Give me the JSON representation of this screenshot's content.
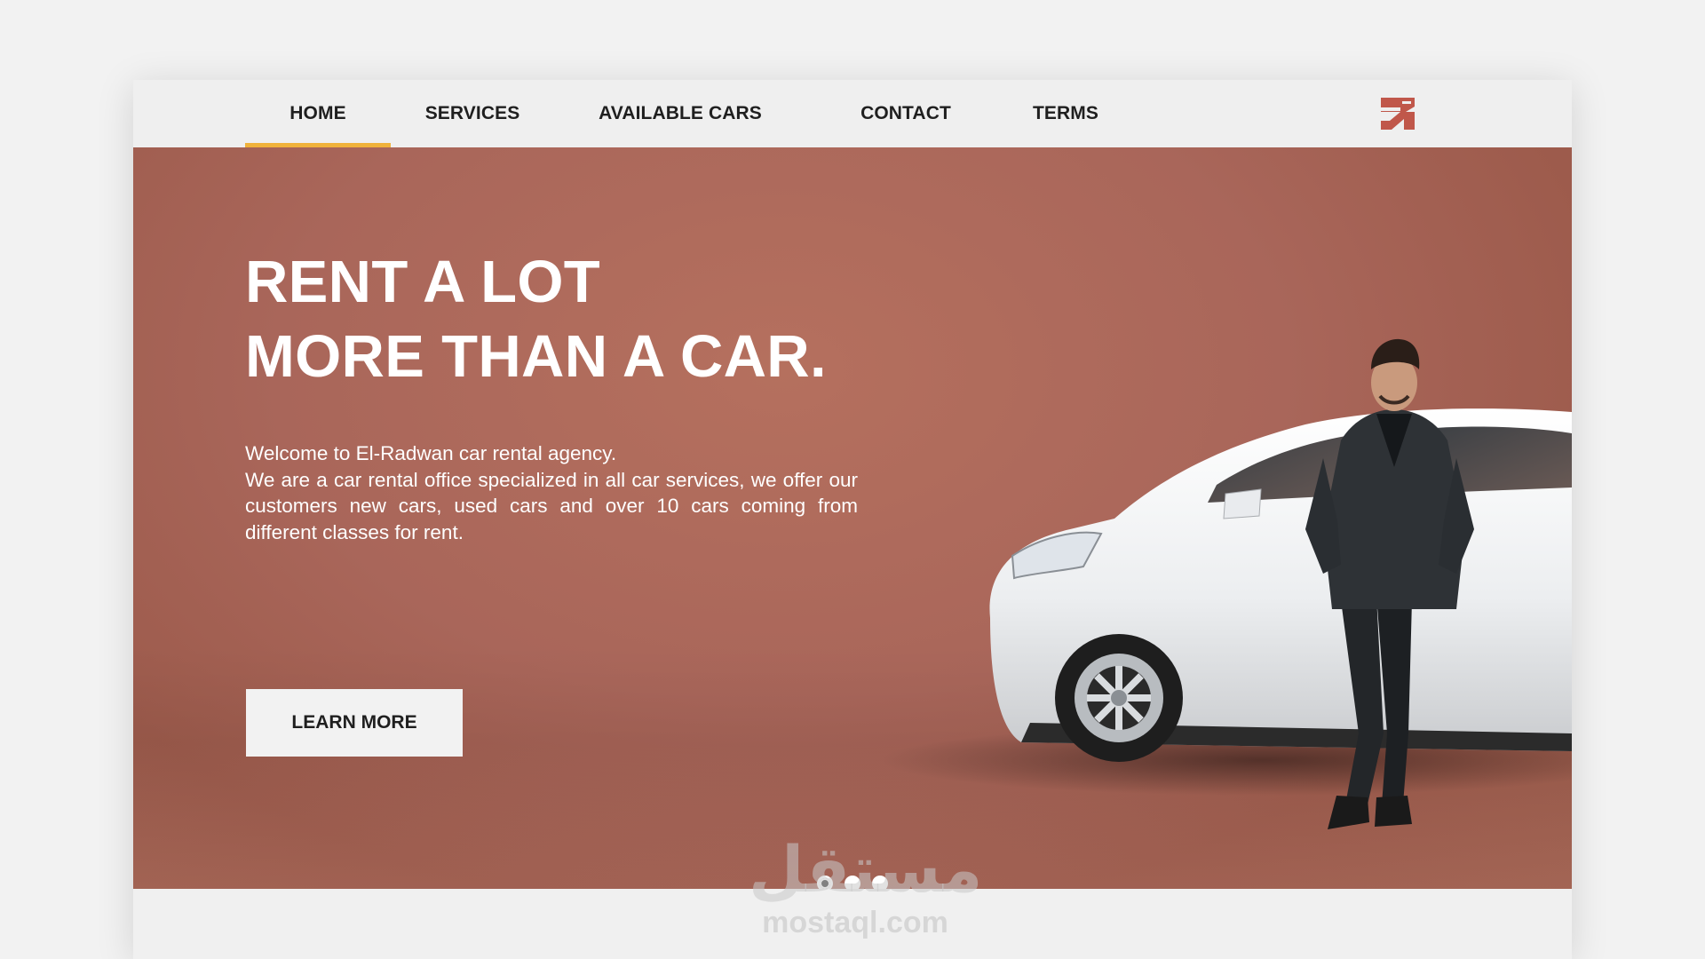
{
  "nav": {
    "items": [
      {
        "label": "HOME",
        "active": true
      },
      {
        "label": "SERVICES",
        "active": false
      },
      {
        "label": "AVAILABLE CARS",
        "active": false
      },
      {
        "label": "CONTACT",
        "active": false
      },
      {
        "label": "TERMS",
        "active": false
      }
    ],
    "active_underline_color": "#f0b23b",
    "logo_icon": "er-monogram-logo"
  },
  "hero": {
    "headline": [
      "RENT A LOT",
      "MORE THAN A CAR."
    ],
    "intro_first_line": "Welcome to El-Radwan car rental agency.",
    "intro_body": "We are a car rental office specialized in all car services, we offer our customers new cars, used cars and over 10 cars coming from different classes for rent.",
    "cta_label": "LEARN MORE",
    "background_color": "#a9665a",
    "image_subject": "man-leaning-on-white-car",
    "slider": {
      "slide_count": 3,
      "active_index": 0
    }
  },
  "watermark": {
    "arabic": "مستقل",
    "latin": "mostaql.com"
  },
  "colors": {
    "brand": "#c0574a",
    "accent": "#f0b23b",
    "nav_text": "#1f1f1f"
  }
}
